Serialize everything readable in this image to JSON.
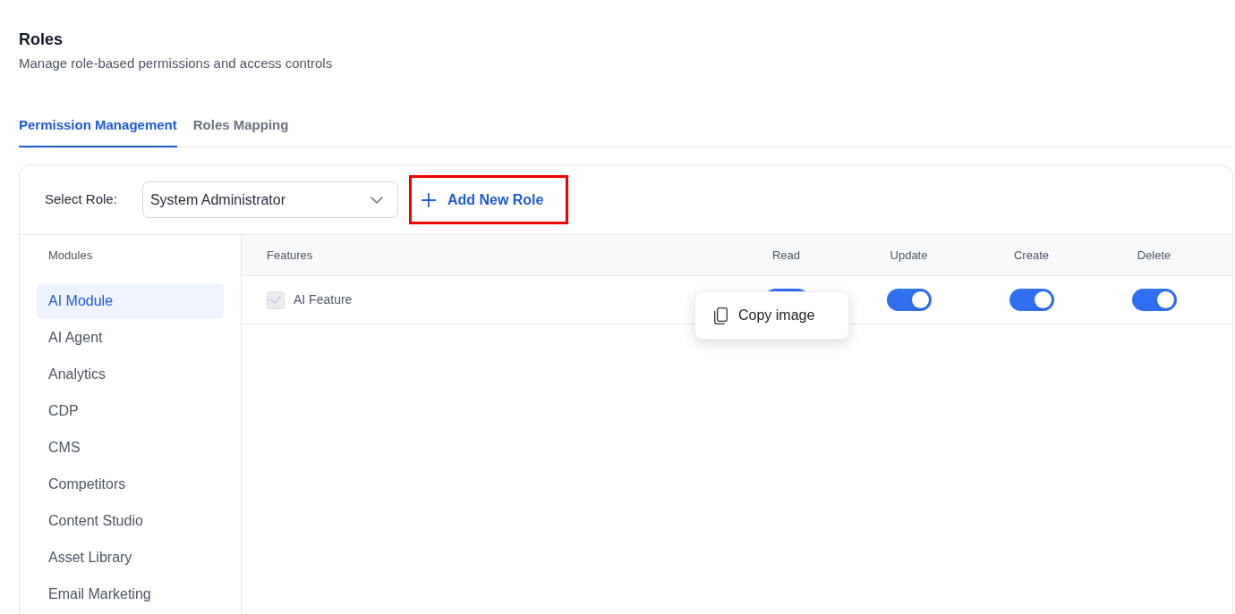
{
  "page": {
    "title": "Roles",
    "subtitle": "Manage role-based permissions and access controls"
  },
  "tabs": [
    {
      "label": "Permission Management",
      "selected": true
    },
    {
      "label": "Roles Mapping",
      "selected": false
    }
  ],
  "role_picker": {
    "label": "Select Role:",
    "value": "System Administrator"
  },
  "add_role_button": {
    "label": "Add New Role",
    "highlighted": true
  },
  "modules": {
    "heading": "Modules",
    "items": [
      {
        "label": "AI Module",
        "selected": true
      },
      {
        "label": "AI Agent",
        "selected": false
      },
      {
        "label": "Analytics",
        "selected": false
      },
      {
        "label": "CDP",
        "selected": false
      },
      {
        "label": "CMS",
        "selected": false
      },
      {
        "label": "Competitors",
        "selected": false
      },
      {
        "label": "Content Studio",
        "selected": false
      },
      {
        "label": "Asset Library",
        "selected": false
      },
      {
        "label": "Email Marketing",
        "selected": false
      }
    ]
  },
  "features_table": {
    "columns": [
      "Features",
      "Read",
      "Update",
      "Create",
      "Delete"
    ],
    "rows": [
      {
        "feature": "AI Feature",
        "checked": true,
        "disabled": true,
        "permissions": [
          {
            "on": true
          },
          {
            "on": true
          },
          {
            "on": true
          },
          {
            "on": true
          }
        ]
      }
    ]
  },
  "context_menu": {
    "items": [
      {
        "label": "Copy image"
      }
    ]
  }
}
